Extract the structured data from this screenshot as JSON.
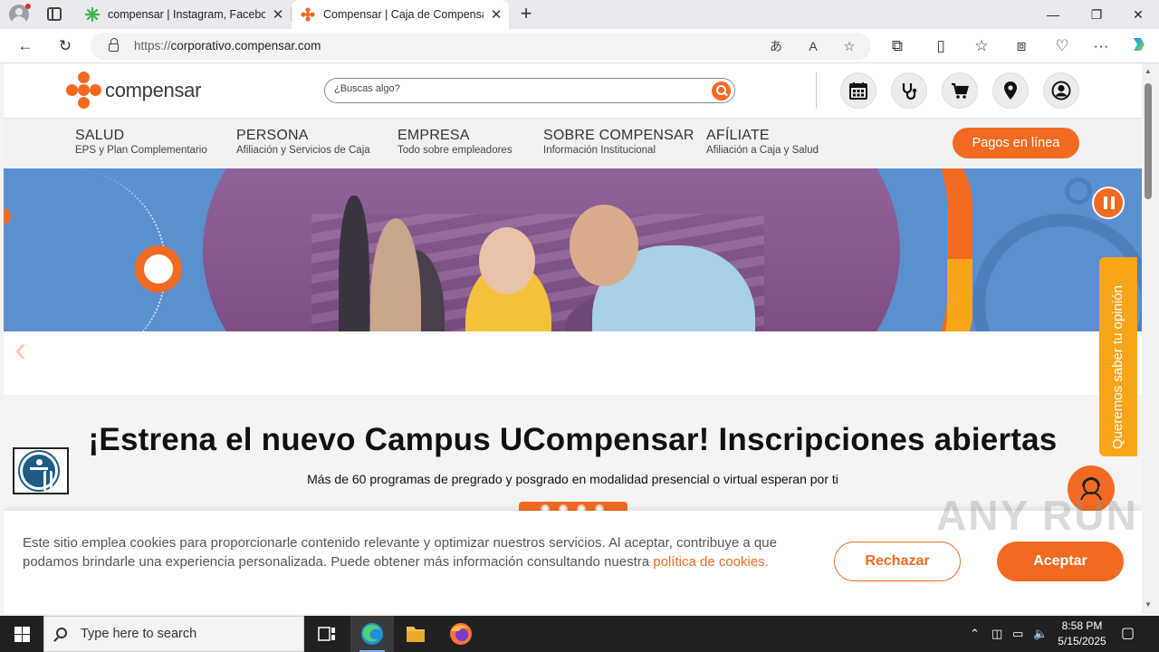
{
  "browser": {
    "tabs": [
      {
        "title": "compensar | Instagram, Faceboo",
        "active": false
      },
      {
        "title": "Compensar | Caja de Compensac",
        "active": true
      }
    ],
    "url_prefix": "https://",
    "url_host": "corporativo.compensar.com"
  },
  "site": {
    "logo_text": "compensar",
    "search_placeholder": "¿Buscas algo?",
    "header_icons": [
      "calendar-icon",
      "stethoscope-icon",
      "cart-icon",
      "location-pin-icon",
      "user-icon"
    ],
    "nav": [
      {
        "title": "SALUD",
        "subtitle": "EPS y Plan Complementario"
      },
      {
        "title": "PERSONA",
        "subtitle": "Afiliación y Servicios de Caja"
      },
      {
        "title": "EMPRESA",
        "subtitle": "Todo sobre empleadores"
      },
      {
        "title": "SOBRE COMPENSAR",
        "subtitle": "Información Institucional"
      },
      {
        "title": "AFÍLIATE",
        "subtitle": "Afiliación a Caja y Salud"
      }
    ],
    "pay_button": "Pagos en línea",
    "banner": {
      "headline": "¡Estrena el nuevo Campus UCompensar! Inscripciones abiertas",
      "subline": "Más de 60 programas de pregrado y posgrado en modalidad presencial o virtual esperan por ti",
      "slide_dots": 4
    },
    "feedback_tab": "Queremos saber tu opinión",
    "cookie": {
      "text": "Este sitio emplea cookies para proporcionarle contenido relevante y optimizar nuestros servicios. Al aceptar, contribuye a que podamos brindarle una experiencia personalizada. Puede obtener más información consultando nuestra ",
      "link": "política de cookies.",
      "reject": "Rechazar",
      "accept": "Aceptar"
    },
    "watermark": "ANY RUN"
  },
  "taskbar": {
    "search_placeholder": "Type here to search",
    "time": "8:58 PM",
    "date": "5/15/2025"
  },
  "colors": {
    "brand_orange": "#f26a21",
    "brand_yellow": "#f9a51a",
    "hero_blue": "#5b8fd0"
  }
}
